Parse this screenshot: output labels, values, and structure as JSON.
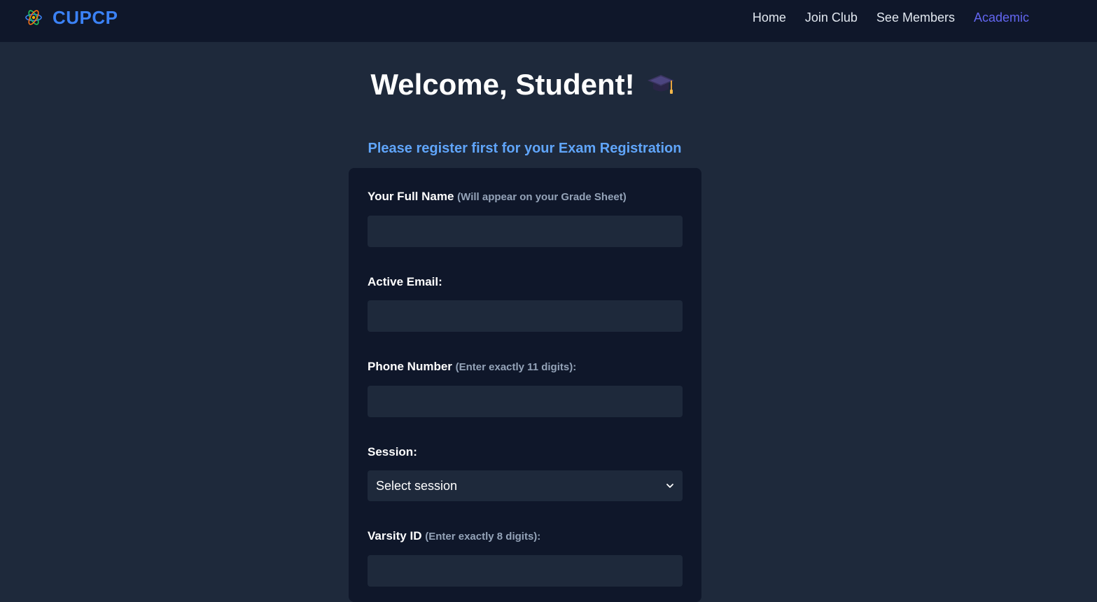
{
  "header": {
    "brand": "CUPCP",
    "nav": [
      {
        "label": "Home"
      },
      {
        "label": "Join Club"
      },
      {
        "label": "See Members"
      },
      {
        "label": "Academic"
      }
    ],
    "active_nav": "Academic",
    "colors": {
      "brand": "#3b82f6",
      "active": "#6366f1",
      "bar": "#0f172a"
    }
  },
  "main": {
    "title": "Welcome, Student!",
    "title_icon": "graduation-cap-icon",
    "subtitle": "Please register first for your Exam Registration"
  },
  "form": {
    "full_name": {
      "label": "Your Full Name",
      "hint": "(Will appear on your Grade Sheet)",
      "value": ""
    },
    "email": {
      "label": "Active Email:",
      "value": ""
    },
    "phone": {
      "label": "Phone Number",
      "hint": "(Enter exactly 11 digits):",
      "value": ""
    },
    "session": {
      "label": "Session:",
      "selected": "Select session"
    },
    "varsity_id": {
      "label": "Varsity ID",
      "hint": "(Enter exactly 8 digits):",
      "value": ""
    }
  }
}
